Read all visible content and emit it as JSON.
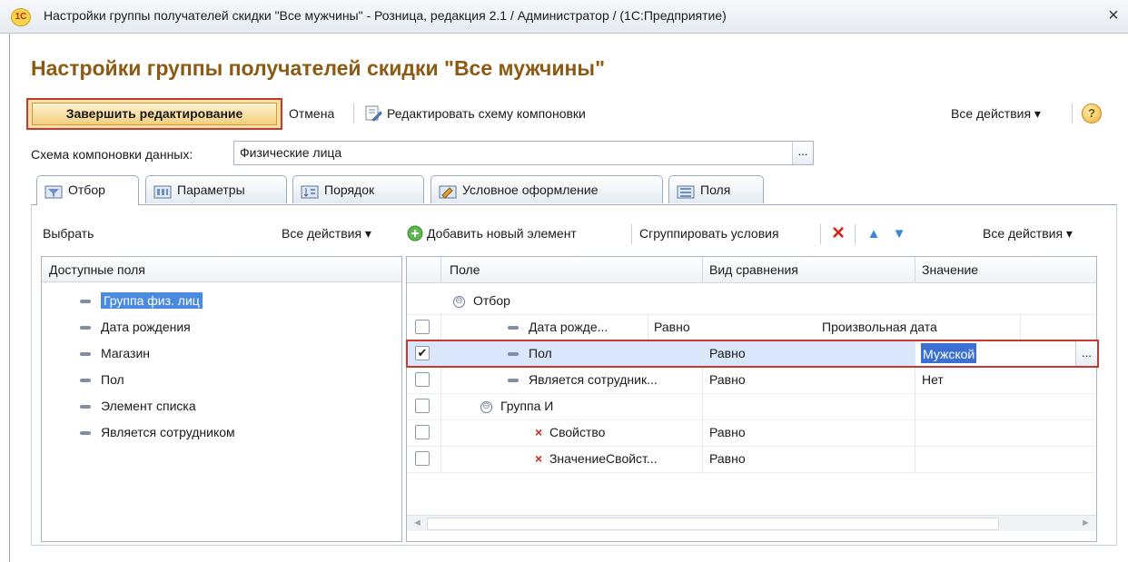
{
  "window": {
    "logo": "1С",
    "title": "Настройки группы получателей скидки \"Все мужчины\" - Розница, редакция 2.1 / Администратор /  (1С:Предприятие)",
    "close": "×"
  },
  "heading": "Настройки группы получателей скидки \"Все мужчины\"",
  "toolbar": {
    "finish": "Завершить редактирование",
    "cancel": "Отмена",
    "edit_schema": "Редактировать схему компоновки",
    "all_actions": "Все действия ▾",
    "help": "?"
  },
  "schema": {
    "label": "Схема компоновки данных:",
    "value": "Физические лица",
    "dots": "..."
  },
  "tabs": [
    {
      "label": "Отбор"
    },
    {
      "label": "Параметры"
    },
    {
      "label": "Порядок"
    },
    {
      "label": "Условное оформление"
    },
    {
      "label": "Поля"
    }
  ],
  "left": {
    "select": "Выбрать",
    "all_actions": "Все действия ▾",
    "header": "Доступные поля",
    "items": [
      "Группа физ. лиц",
      "Дата рождения",
      "Магазин",
      "Пол",
      "Элемент списка",
      "Является сотрудником"
    ]
  },
  "right": {
    "add": "Добавить новый элемент",
    "group": "Сгруппировать условия",
    "all_actions": "Все действия ▾",
    "columns": [
      "Поле",
      "Вид сравнения",
      "Значение"
    ],
    "rows": [
      {
        "field": "Отбор",
        "cmp": "",
        "val": ""
      },
      {
        "field": "Дата рожде...",
        "cmp": "Равно",
        "val": "Произвольная дата"
      },
      {
        "field": "Пол",
        "cmp": "Равно",
        "val": "Мужской",
        "checked": "✔"
      },
      {
        "field": "Является сотрудник...",
        "cmp": "Равно",
        "val": "Нет"
      },
      {
        "field": "Группа И",
        "cmp": "",
        "val": ""
      },
      {
        "field": "Свойство",
        "cmp": "Равно",
        "val": ""
      },
      {
        "field": "ЗначениеСвойст...",
        "cmp": "Равно",
        "val": ""
      }
    ],
    "dots": "..."
  },
  "icons": {
    "tree_collapse": "⊖",
    "remove": "×",
    "up": "▲",
    "down": "▼",
    "scroll_left": "◄",
    "scroll_right": "►"
  }
}
